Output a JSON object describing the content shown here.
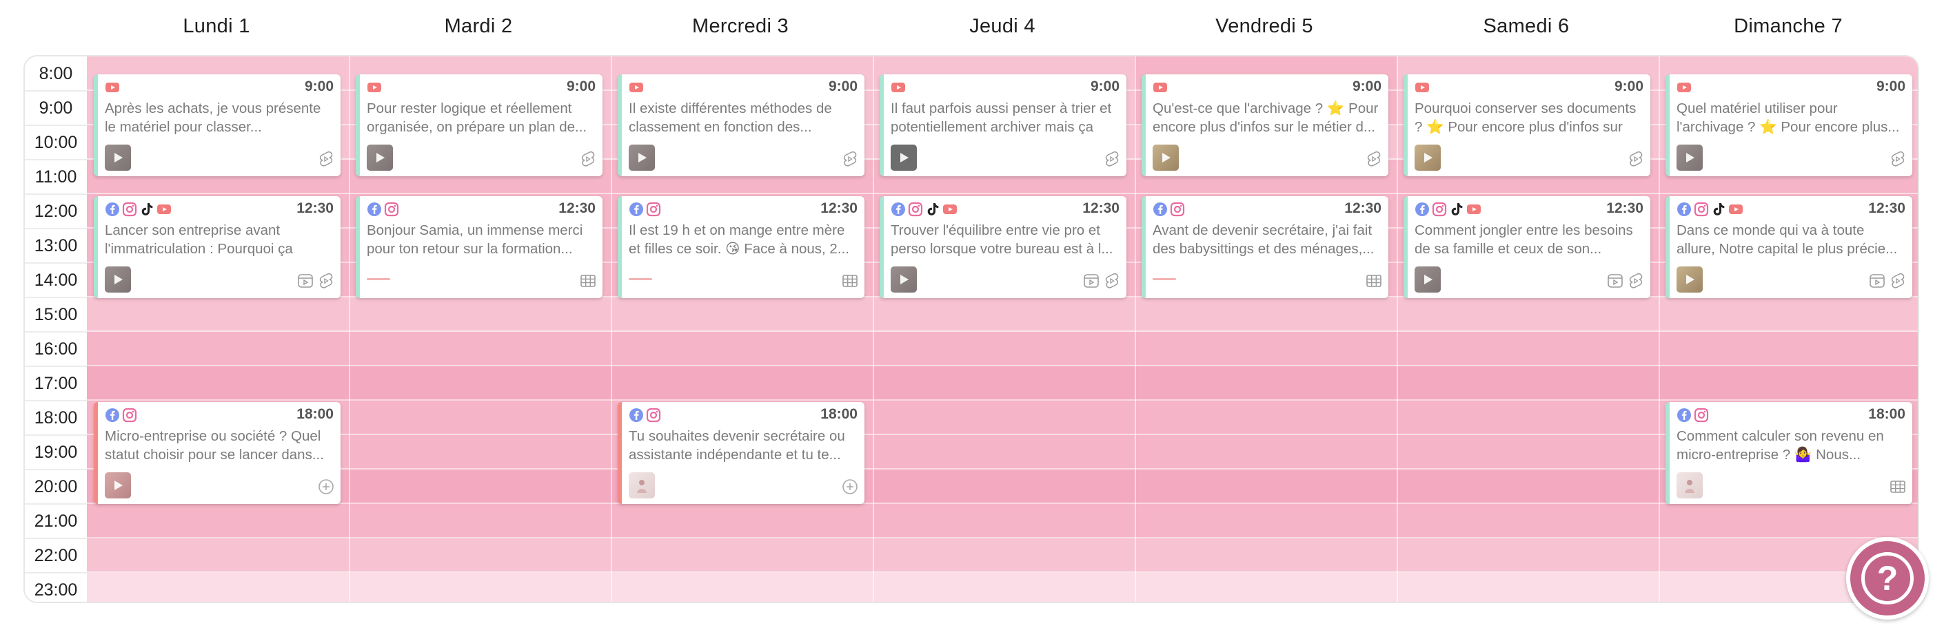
{
  "days": [
    "Lundi 1",
    "Mardi 2",
    "Mercredi 3",
    "Jeudi 4",
    "Vendredi 5",
    "Samedi 6",
    "Dimanche 7"
  ],
  "times": [
    "8:00",
    "9:00",
    "10:00",
    "11:00",
    "12:00",
    "13:00",
    "14:00",
    "15:00",
    "16:00",
    "17:00",
    "18:00",
    "19:00",
    "20:00",
    "21:00",
    "22:00",
    "23:00"
  ],
  "colors": {
    "cell_light": "#f7c3d3",
    "cell_mid": "#f5b4c7",
    "cell_dark": "#f3a9bf",
    "cell_last": "#fadde6",
    "accent_green": "#a7e6d2",
    "accent_coral": "#f48a86",
    "youtube": "#f27a7a",
    "facebook": "#7b95f0",
    "instagram": "#e96aa0",
    "tiktok": "#222222",
    "help_button": "#c36387"
  },
  "posts": [
    {
      "day": 0,
      "slot": "9:00",
      "time": "9:00",
      "networks": [
        "youtube"
      ],
      "text": "Après les achats, je vous présente le matériel pour classer...",
      "thumb": "video",
      "type": "short-icon",
      "accent": "green"
    },
    {
      "day": 1,
      "slot": "9:00",
      "time": "9:00",
      "networks": [
        "youtube"
      ],
      "text": "Pour rester logique et réellement organisée, on prépare un plan de...",
      "thumb": "video",
      "type": "short-icon",
      "accent": "green"
    },
    {
      "day": 2,
      "slot": "9:00",
      "time": "9:00",
      "networks": [
        "youtube"
      ],
      "text": "Il existe différentes méthodes de classement en fonction des...",
      "thumb": "video",
      "type": "short-icon",
      "accent": "green"
    },
    {
      "day": 3,
      "slot": "9:00",
      "time": "9:00",
      "networks": [
        "youtube"
      ],
      "text": "Il faut parfois aussi penser à trier et potentiellement archiver mais ça o...",
      "thumb": "video-dark",
      "type": "short-icon",
      "accent": "green"
    },
    {
      "day": 4,
      "slot": "9:00",
      "time": "9:00",
      "networks": [
        "youtube"
      ],
      "text": "Qu'est-ce que l'archivage ? ⭐ Pour encore plus d'infos sur le métier d...",
      "thumb": "video-tan",
      "type": "short-icon",
      "accent": "green"
    },
    {
      "day": 5,
      "slot": "9:00",
      "time": "9:00",
      "networks": [
        "youtube"
      ],
      "text": "Pourquoi conserver ses documents ? ⭐ Pour encore plus d'infos sur l...",
      "thumb": "video-tan",
      "type": "short-icon",
      "accent": "green"
    },
    {
      "day": 6,
      "slot": "9:00",
      "time": "9:00",
      "networks": [
        "youtube"
      ],
      "text": "Quel matériel utiliser pour l'archivage ? ⭐ Pour encore plus...",
      "thumb": "video",
      "type": "short-icon",
      "accent": "green"
    },
    {
      "day": 0,
      "slot": "12:30",
      "time": "12:30",
      "networks": [
        "facebook",
        "instagram",
        "tiktok",
        "youtube"
      ],
      "text": "Lancer son entreprise avant l'immatriculation : Pourquoi ça vau...",
      "thumb": "video",
      "type": "reel-short",
      "accent": "green"
    },
    {
      "day": 1,
      "slot": "12:30",
      "time": "12:30",
      "networks": [
        "facebook",
        "instagram"
      ],
      "text": "Bonjour Samia, un immense merci pour ton retour sur la formation...",
      "thumb": "strip",
      "type": "grid-icon",
      "accent": "green"
    },
    {
      "day": 2,
      "slot": "12:30",
      "time": "12:30",
      "networks": [
        "facebook",
        "instagram"
      ],
      "text": "Il est 19 h et on mange entre mère et filles ce soir. 😘  Face à nous, 2...",
      "thumb": "strip",
      "type": "grid-icon",
      "accent": "green"
    },
    {
      "day": 3,
      "slot": "12:30",
      "time": "12:30",
      "networks": [
        "facebook",
        "instagram",
        "tiktok",
        "youtube"
      ],
      "text": "Trouver l'équilibre entre vie pro et perso lorsque votre bureau est à l...",
      "thumb": "video",
      "type": "reel-short",
      "accent": "green"
    },
    {
      "day": 4,
      "slot": "12:30",
      "time": "12:30",
      "networks": [
        "facebook",
        "instagram"
      ],
      "text": "Avant de devenir secrétaire, j'ai fait des babysittings et des ménages,...",
      "thumb": "strip",
      "type": "grid-icon",
      "accent": "green"
    },
    {
      "day": 5,
      "slot": "12:30",
      "time": "12:30",
      "networks": [
        "facebook",
        "instagram",
        "tiktok",
        "youtube"
      ],
      "text": "Comment jongler entre les besoins de sa famille et ceux de son...",
      "thumb": "video",
      "type": "reel-short",
      "accent": "green"
    },
    {
      "day": 6,
      "slot": "12:30",
      "time": "12:30",
      "networks": [
        "facebook",
        "instagram",
        "tiktok",
        "youtube"
      ],
      "text": "Dans ce monde qui va à toute allure, Notre capital le plus précie...",
      "thumb": "video-tan",
      "type": "reel-short",
      "accent": "green"
    },
    {
      "day": 0,
      "slot": "18:00",
      "time": "18:00",
      "networks": [
        "facebook",
        "instagram"
      ],
      "text": "Micro-entreprise ou société ? Quel statut choisir pour se lancer dans...",
      "thumb": "video-pink",
      "type": "plus-icon",
      "accent": "coral"
    },
    {
      "day": 2,
      "slot": "18:00",
      "time": "18:00",
      "networks": [
        "facebook",
        "instagram"
      ],
      "text": "Tu souhaites devenir secrétaire ou assistante indépendante et tu te...",
      "thumb": "photo",
      "type": "plus-icon",
      "accent": "coral"
    },
    {
      "day": 6,
      "slot": "18:00",
      "time": "18:00",
      "networks": [
        "facebook",
        "instagram"
      ],
      "text": "Comment calculer son revenu en micro-entreprise ? 🤷‍♀️ Nous...",
      "thumb": "photo",
      "type": "grid-icon",
      "accent": "green"
    }
  ],
  "help_label": "?"
}
